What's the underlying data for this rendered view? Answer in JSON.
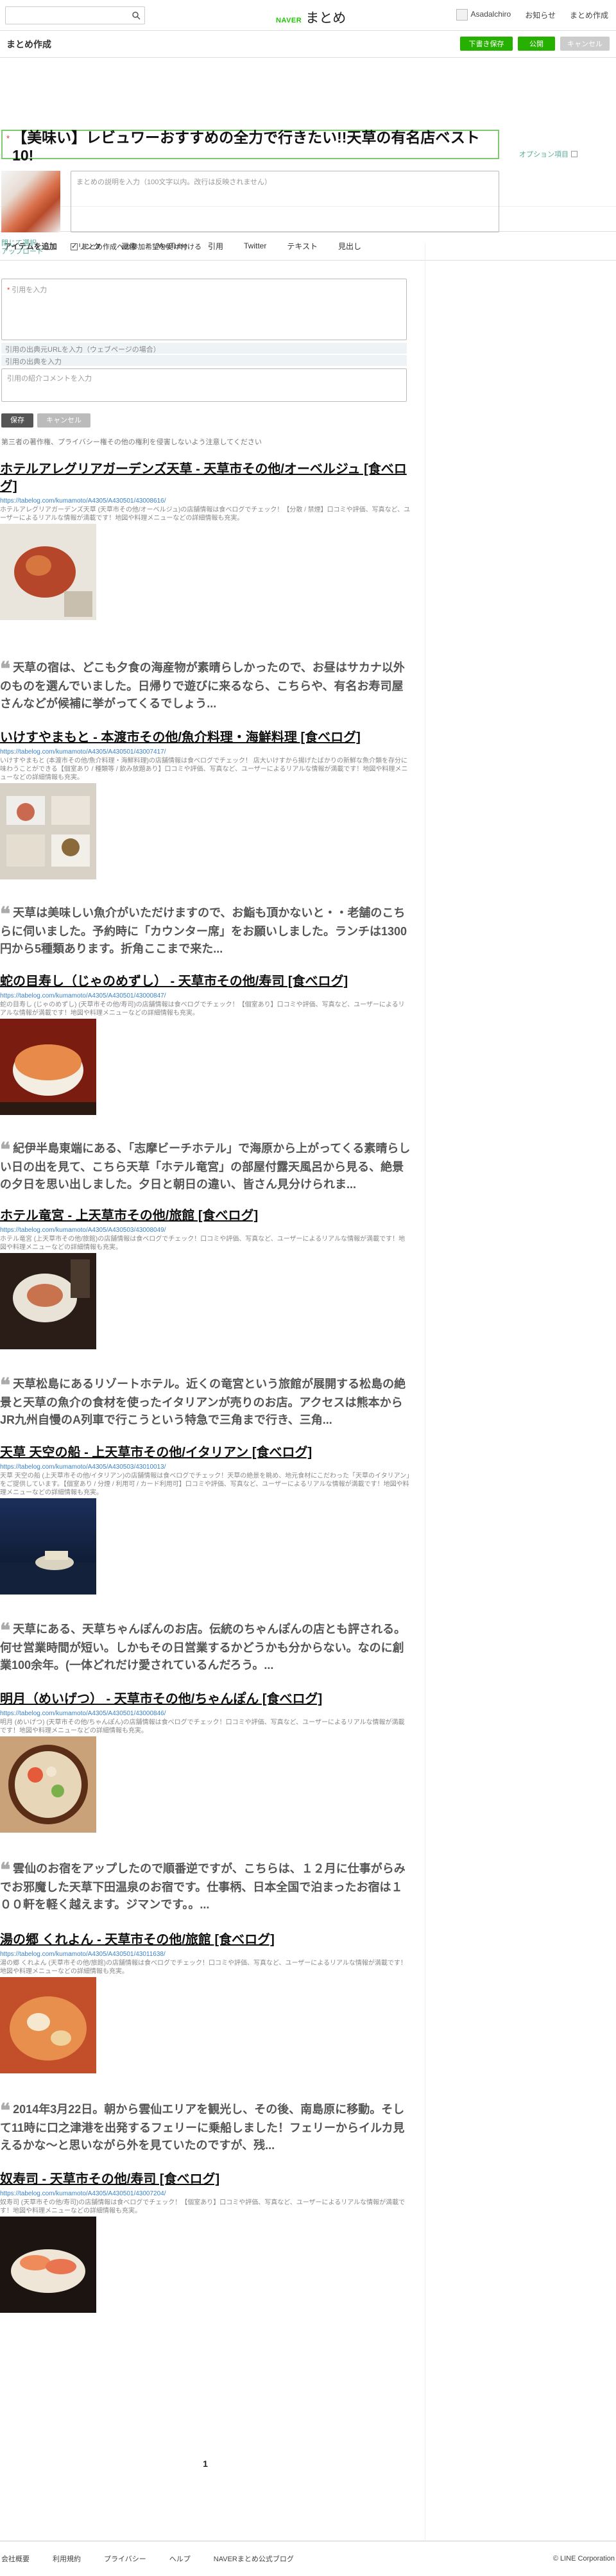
{
  "gbar": {
    "logo_naver": "NAVER",
    "logo_matome": "まとめ",
    "user": "Asadalchiro",
    "notice": "お知らせ",
    "mypage": "まとめ作成"
  },
  "title_row": {
    "title": "まとめ作成",
    "btn_draft": "下書き保存",
    "btn_publish": "公開",
    "btn_cancel": "キャンセル"
  },
  "header": {
    "title_text": "【美味い】レビュワーおすすめの全力で行きたい!!天草の有名店ベスト10!",
    "option_link": "オプション項目",
    "desc_placeholder": "まとめの説明を入力（100文字以内。改行は反映されません）",
    "thumb_link1": "閉じて選択",
    "thumb_link2": "アップロード",
    "checkbox_label": "まとめ作成への参加希望を受け付ける"
  },
  "tabs": [
    "アイテムを追加",
    "リンク",
    "画像",
    "YouTube",
    "引用",
    "Twitter",
    "テキスト",
    "見出し"
  ],
  "form": {
    "quote_placeholder": "引用を入力",
    "src_placeholder": "引用の出典元URLを入力（ウェブページの場合）",
    "src2_placeholder": "引用の出典を入力",
    "comment_placeholder": "引用の紹介コメントを入力",
    "save": "保存",
    "cancel": "キャンセル",
    "warning": "第三者の著作権、プライバシー権その他の権利を侵害しないよう注意してください"
  },
  "entries": [
    {
      "title": "ホテルアレグリアガーデンズ天草 - 天草市その他/オーベルジュ [食べログ]",
      "url": "https://tabelog.com/kumamoto/A4305/A430501/43008616/",
      "desc": "ホテルアレグリアガーデンズ天草 (天草市その他/オーベルジュ)の店舗情報は食べログでチェック！【分散 / 禁煙】口コミや評価、写真など、ユーザーによるリアルな情報が満載です！地図や料理メニューなどの詳細情報も充実。",
      "quote": "天草の宿は、どこも夕食の海産物が素晴らしかったので、お昼はサカナ以外のものを選んでいました。日帰りで遊びに来るなら、こちらや、有名お寿司屋さんなどが候補に挙がってくるでしょう..."
    },
    {
      "title": "いけすやまもと - 本渡市その他/魚介料理・海鮮料理 [食べログ]",
      "url": "https://tabelog.com/kumamoto/A4305/A430501/43007417/",
      "desc": "いけすやまもと (本渡市その他/魚介料理・海鮮料理)の店舗情報は食べログでチェック！ 店大いけすから揚げたばかりの新鮮な魚介類を存分に味わうことができる【個室あり / 種類等 / 飲み放題あり】口コミや評価、写真など、ユーザーによるリアルな情報が満載です！地図や料理メニューなどの詳細情報も充実。",
      "quote": "天草は美味しい魚介がいただけますので、お鮨も頂かないと・・老舗のこちらに伺いました。予約時に「カウンター席」をお願いしました。ランチは1300円から5種類あります。折角ここまで来た..."
    },
    {
      "title": "蛇の目寿し（じゃのめずし） - 天草市その他/寿司 [食べログ]",
      "url": "https://tabelog.com/kumamoto/A4305/A430501/43000847/",
      "desc": "蛇の目寿し (じゃのめずし) (天草市その他/寿司)の店舗情報は食べログでチェック！【個室あり】口コミや評価、写真など、ユーザーによるリアルな情報が満載です！地図や料理メニューなどの詳細情報も充実。",
      "quote": "紀伊半島東端にある、「志摩ビーチホテル」で海原から上がってくる素晴らしい日の出を見て、こちら天草「ホテル竜宮」の部屋付露天風呂から見る、絶景の夕日を思い出しました。夕日と朝日の違い、皆さん見分けられま..."
    },
    {
      "title": "ホテル竜宮 - 上天草市その他/旅館 [食べログ]",
      "url": "https://tabelog.com/kumamoto/A4305/A430503/43008049/",
      "desc": "ホテル竜宮 (上天草市その他/旅館)の店舗情報は食べログでチェック！口コミや評価、写真など、ユーザーによるリアルな情報が満載です！地図や料理メニューなどの詳細情報も充実。",
      "quote": "天草松島にあるリゾートホテル。近くの竜宮という旅館が展開する松島の絶景と天草の魚介の食材を使ったイタリアンが売りのお店。アクセスは熊本からJR九州自慢のA列車で行こうという特急で三角まで行き、三角..."
    },
    {
      "title": "天草 天空の船 - 上天草市その他/イタリアン [食べログ]",
      "url": "https://tabelog.com/kumamoto/A4305/A430503/43010013/",
      "desc": "天草 天空の船 (上天草市その他/イタリアン)の店舗情報は食べログでチェック！天草の絶景を眺め、地元食材にこだわった「天草のイタリアン」をご提供しています。【個室あり / 分煙 / 利用可 / カード利用可】口コミや評価、写真など、ユーザーによるリアルな情報が満載です！地図や料理メニューなどの詳細情報も充実。",
      "quote": "天草にある、天草ちゃんぽんのお店。伝統のちゃんぽんの店とも評される。何せ営業時間が短い。しかもその日営業するかどうかも分からない。なのに創業100余年。(一体どれだけ愛されているんだろう。..."
    },
    {
      "title": "明月（めいげつ） - 天草市その他/ちゃんぽん [食べログ]",
      "url": "https://tabelog.com/kumamoto/A4305/A430501/43000846/",
      "desc": "明月 (めいげつ) (天草市その他/ちゃんぽん)の店舗情報は食べログでチェック！口コミや評価、写真など、ユーザーによるリアルな情報が満載です！地図や料理メニューなどの詳細情報も充実。",
      "quote": "雲仙のお宿をアップしたので順番逆ですが、こちらは、１２月に仕事がらみでお邪魔した天草下田温泉のお宿です。仕事柄、日本全国で泊まったお宿は１００軒を軽く越えます。ジマンです。。..."
    },
    {
      "title": "湯の郷 くれよん - 天草市その他/旅館 [食べログ]",
      "url": "https://tabelog.com/kumamoto/A4305/A430501/43011638/",
      "desc": "湯の郷 くれよん (天草市その他/旅館)の店舗情報は食べログでチェック！口コミや評価、写真など、ユーザーによるリアルな情報が満載です！地図や料理メニューなどの詳細情報も充実。",
      "quote": "2014年3月22日。朝から雲仙エリアを観光し、その後、南島原に移動。そして11時に口之津港を出発するフェリーに乗船しました！フェリーからイルカ見えるかな〜と思いながら外を見ていたのですが、残..."
    },
    {
      "title": "奴寿司 - 天草市その他/寿司 [食べログ]",
      "url": "https://tabelog.com/kumamoto/A4305/A430501/43007204/",
      "desc": "奴寿司 (天草市その他/寿司)の店舗情報は食べログでチェック！【個室あり】口コミや評価、写真など、ユーザーによるリアルな情報が満載です！地図や料理メニューなどの詳細情報も充実。",
      "quote": ""
    }
  ],
  "pager": "1",
  "footer": {
    "links": [
      "会社概要",
      "利用規約",
      "プライバシー",
      "ヘルプ",
      "NAVERまとめ公式ブログ"
    ],
    "corp": "© LINE Corporation"
  }
}
